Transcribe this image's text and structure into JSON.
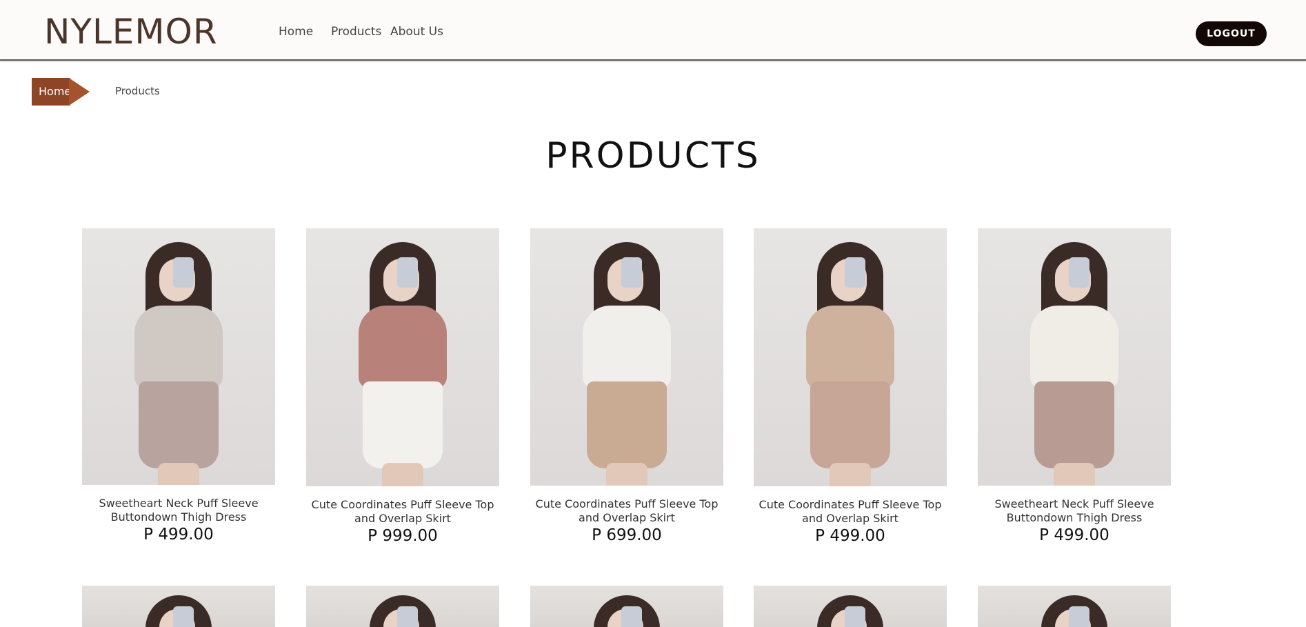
{
  "brand": {
    "logo": "NYLEMOR"
  },
  "nav": [
    {
      "label": "Home"
    },
    {
      "label": "Products"
    },
    {
      "label": "About Us"
    }
  ],
  "header": {
    "logout_label": "LOGOUT"
  },
  "breadcrumb": {
    "home": "Home",
    "current": "Products"
  },
  "page": {
    "title": "PRODUCTS"
  },
  "products": [
    {
      "name": "Sweetheart Neck Puff Sleeve Buttondown Thigh Dress",
      "price": "P 499.00",
      "top_color": "#cfc8c3",
      "bottom_color": "#b9a39e"
    },
    {
      "name": "Cute Coordinates Puff Sleeve Top and Overlap Skirt",
      "price": "P 999.00",
      "top_color": "#b8827a",
      "bottom_color": "#f3f1ee"
    },
    {
      "name": "Cute Coordinates Puff Sleeve Top and Overlap Skirt",
      "price": "P 699.00",
      "top_color": "#f1efec",
      "bottom_color": "#c9aa92"
    },
    {
      "name": "Cute Coordinates Puff Sleeve Top and Overlap Skirt",
      "price": "P 499.00",
      "top_color": "#cfb29d",
      "bottom_color": "#c7a698"
    },
    {
      "name": "Sweetheart Neck Puff Sleeve Buttondown Thigh Dress",
      "price": "P 499.00",
      "top_color": "#f0ece6",
      "bottom_color": "#b89b92"
    }
  ],
  "colors": {
    "accent": "#8e4526",
    "logo": "#4b3428",
    "logout_bg": "#120806"
  }
}
